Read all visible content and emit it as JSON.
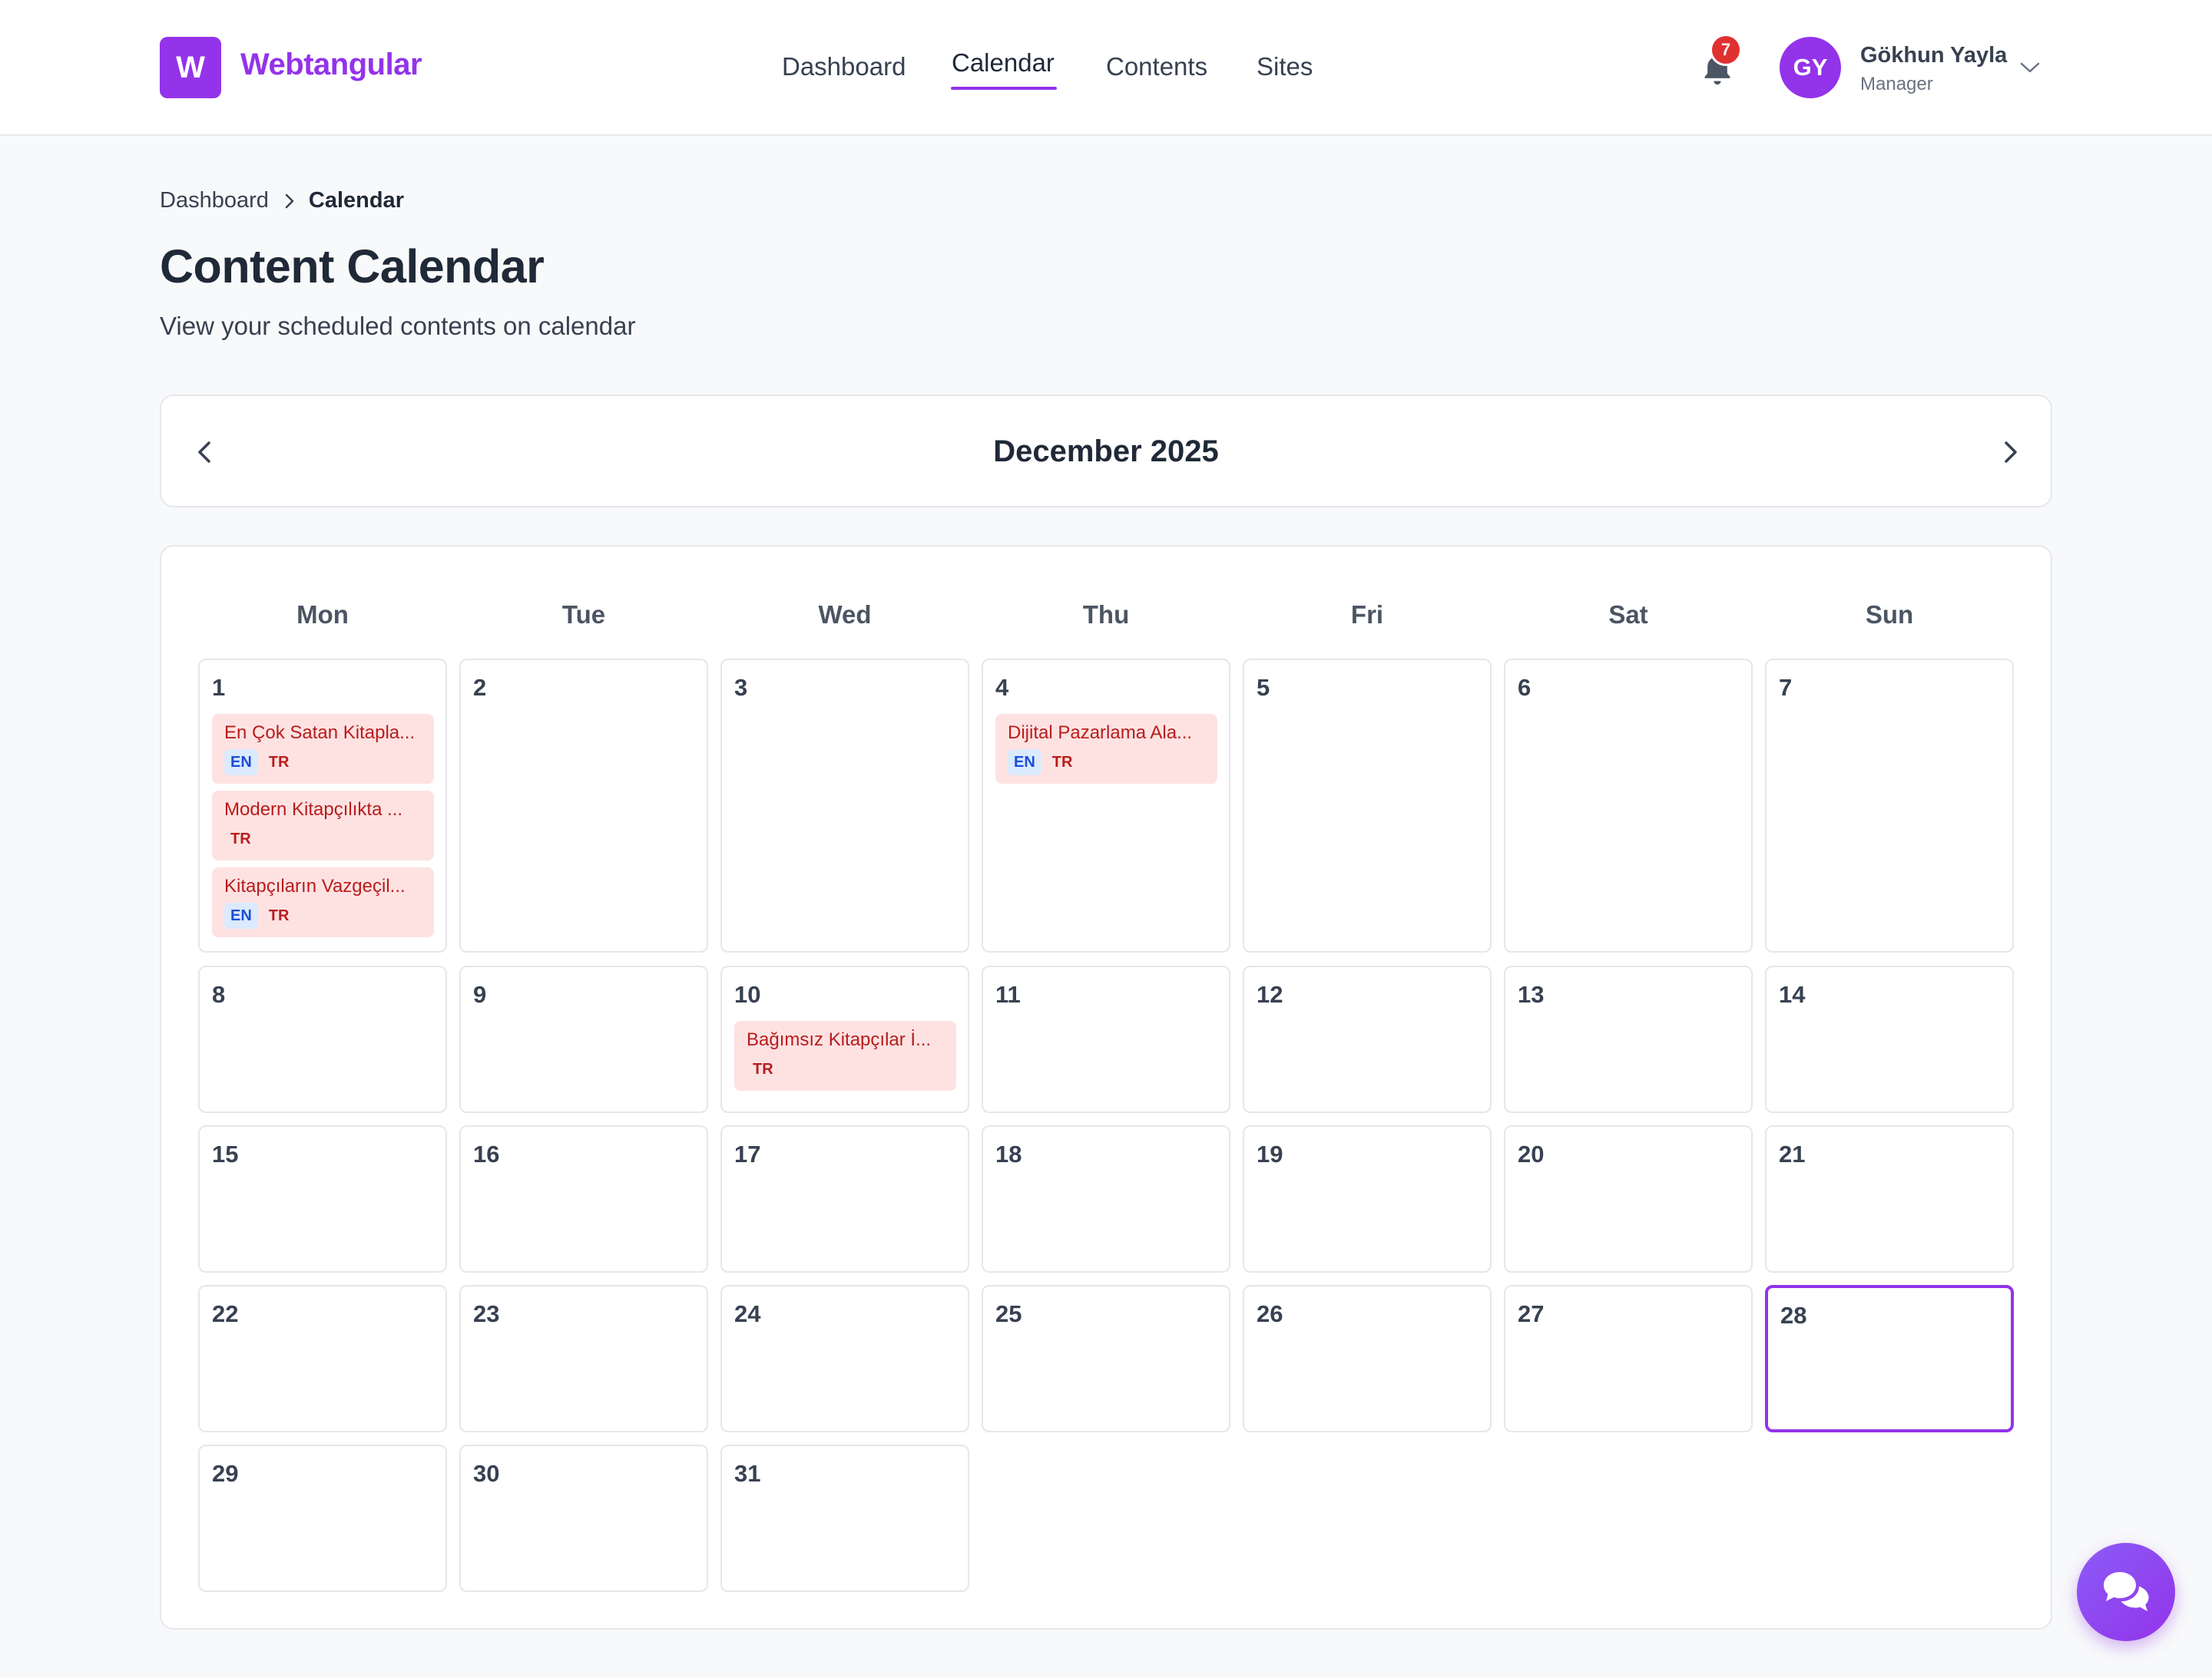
{
  "brand": {
    "logo_letter": "W",
    "name": "Webtangular"
  },
  "nav": {
    "items": [
      {
        "label": "Dashboard"
      },
      {
        "label": "Calendar",
        "active": true
      },
      {
        "label": "Contents"
      },
      {
        "label": "Sites"
      }
    ]
  },
  "notifications": {
    "icon": "bell-icon",
    "count": "7"
  },
  "user": {
    "initials": "GY",
    "name": "Gökhun Yayla",
    "role": "Manager"
  },
  "breadcrumb": {
    "parent": "Dashboard",
    "current": "Calendar"
  },
  "page": {
    "title": "Content Calendar",
    "subtitle": "View your scheduled contents on calendar"
  },
  "calendar": {
    "month_label": "December 2025",
    "weekdays": [
      "Mon",
      "Tue",
      "Wed",
      "Thu",
      "Fri",
      "Sat",
      "Sun"
    ],
    "days": [
      "1",
      "2",
      "3",
      "4",
      "5",
      "6",
      "7",
      "8",
      "9",
      "10",
      "11",
      "12",
      "13",
      "14",
      "15",
      "16",
      "17",
      "18",
      "19",
      "20",
      "21",
      "22",
      "23",
      "24",
      "25",
      "26",
      "27",
      "28",
      "29",
      "30",
      "31"
    ],
    "today": "28",
    "events": [
      {
        "day": "1",
        "title": "En Çok Satan Kitapla...",
        "langs": [
          "EN",
          "TR"
        ]
      },
      {
        "day": "1",
        "title": "Modern Kitapçılıkta ...",
        "langs": [
          "TR"
        ]
      },
      {
        "day": "1",
        "title": "Kitapçıların Vazgeçil...",
        "langs": [
          "EN",
          "TR"
        ]
      },
      {
        "day": "4",
        "title": "Dijital Pazarlama Ala...",
        "langs": [
          "EN",
          "TR"
        ]
      },
      {
        "day": "10",
        "title": "Bağımsız Kitapçılar İ...",
        "langs": [
          "TR"
        ]
      }
    ]
  },
  "colors": {
    "brand": "#9333ea",
    "event_bg": "#fee2e2",
    "event_text": "#b91c1c",
    "badge": "#e03131"
  }
}
